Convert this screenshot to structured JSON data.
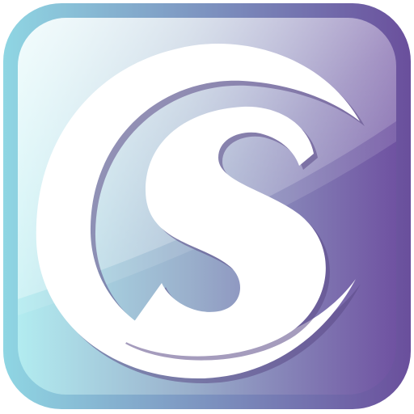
{
  "icon": {
    "name": "cs-logo-app-icon",
    "logo_glyphs": [
      "C",
      "S"
    ],
    "colors": {
      "gradient_left": "#b2ecf0",
      "gradient_mid": "#9ab0cc",
      "gradient_right": "#6f52a1",
      "border_left": "#8fd6e3",
      "border_right": "#6a4f9c",
      "logo_fill": "#ffffff",
      "logo_shadow": "#5b4a86"
    }
  }
}
